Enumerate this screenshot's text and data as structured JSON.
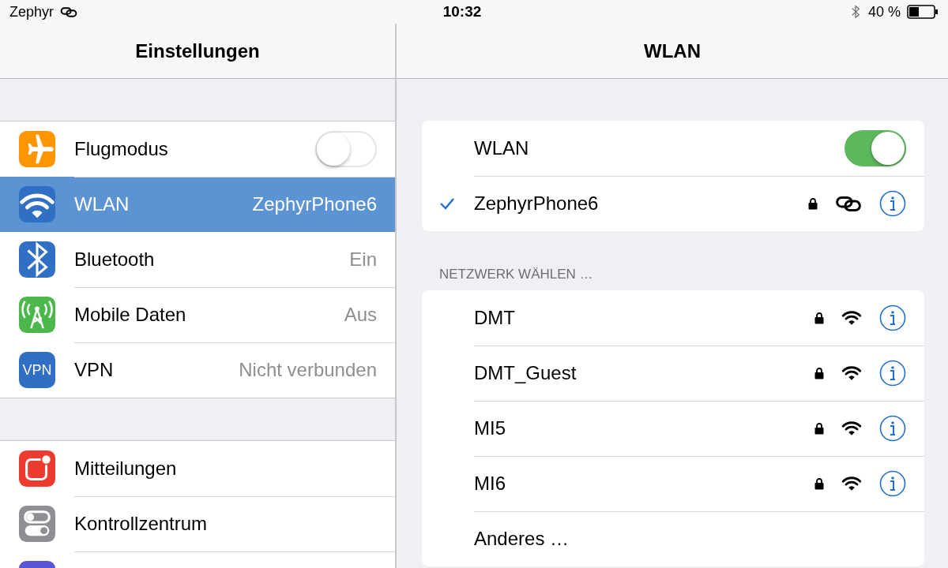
{
  "status_bar": {
    "carrier": "Zephyr",
    "time": "10:32",
    "battery": "40 %"
  },
  "sidebar": {
    "title": "Einstellungen",
    "groups": [
      {
        "items": [
          {
            "kind": "toggle",
            "label": "Flugmodus",
            "on": false,
            "selected": false
          },
          {
            "kind": "value",
            "label": "WLAN",
            "value": "ZephyrPhone6",
            "selected": true
          },
          {
            "kind": "value",
            "label": "Bluetooth",
            "value": "Ein",
            "selected": false
          },
          {
            "kind": "value",
            "label": "Mobile Daten",
            "value": "Aus",
            "selected": false
          },
          {
            "kind": "value",
            "label": "VPN",
            "icon_text": "VPN",
            "value": "Nicht verbunden",
            "selected": false
          }
        ]
      },
      {
        "items": [
          {
            "kind": "plain",
            "label": "Mitteilungen",
            "selected": false
          },
          {
            "kind": "plain",
            "label": "Kontrollzentrum",
            "selected": false
          },
          {
            "kind": "plain",
            "selected": false
          }
        ]
      }
    ]
  },
  "detail": {
    "title": "WLAN",
    "wlan": {
      "label": "WLAN",
      "on": true
    },
    "connected": {
      "name": "ZephyrPhone6",
      "checked": true,
      "secured": true,
      "kind": "hotspot"
    },
    "section_header": "NETZWERK WÄHLEN …",
    "networks": [
      {
        "name": "DMT",
        "secured": true,
        "kind": "wifi"
      },
      {
        "name": "DMT_Guest",
        "secured": true,
        "kind": "wifi"
      },
      {
        "name": "MI5",
        "secured": true,
        "kind": "wifi"
      },
      {
        "name": "MI6",
        "secured": true,
        "kind": "wifi"
      },
      {
        "name": "Anderes …",
        "kind": "other"
      }
    ]
  }
}
